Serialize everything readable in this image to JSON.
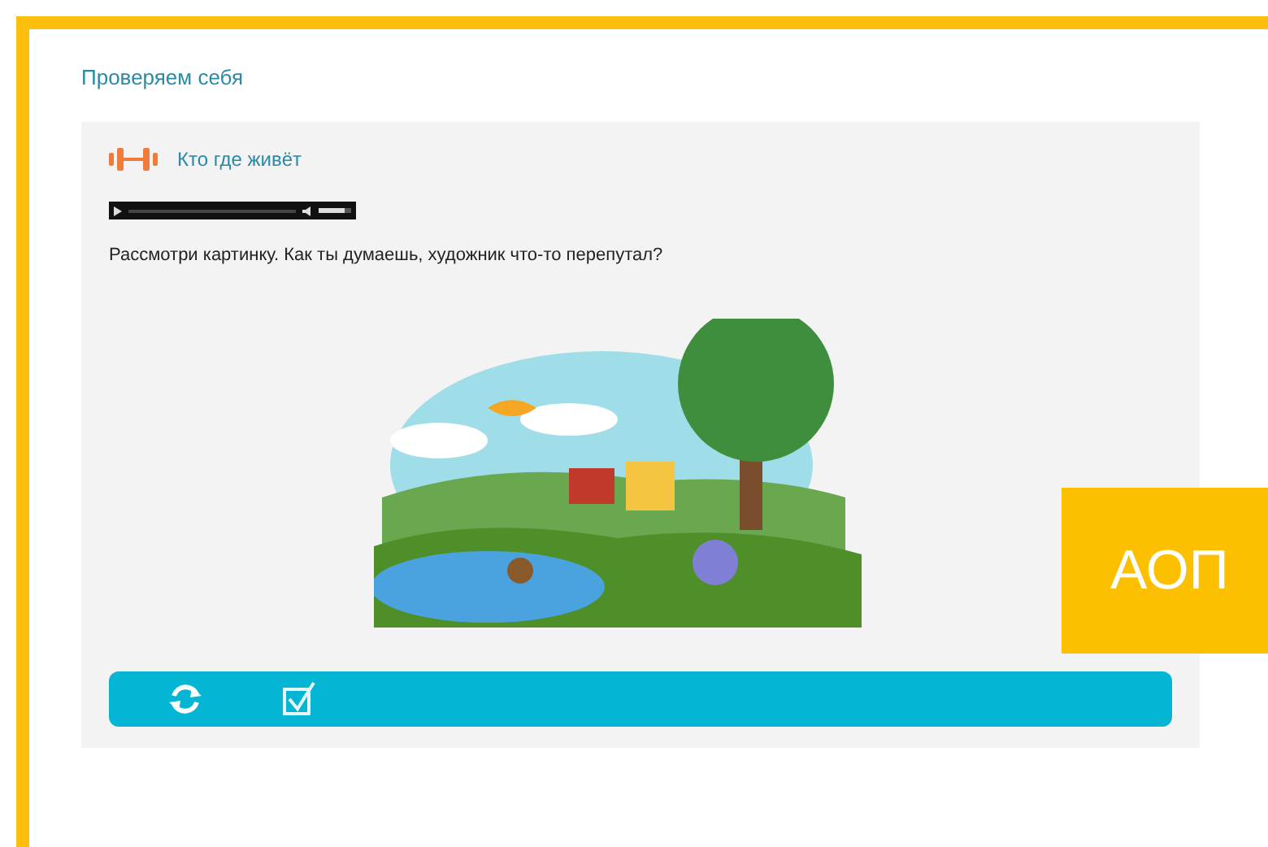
{
  "section_title": "Проверяем себя",
  "exercise": {
    "title": "Кто где живёт",
    "question": "Рассмотри картинку. Как ты думаешь, художник что-то перепутал?"
  },
  "audio": {
    "volume": {
      "level": 0.8
    }
  },
  "badge": "АОП"
}
